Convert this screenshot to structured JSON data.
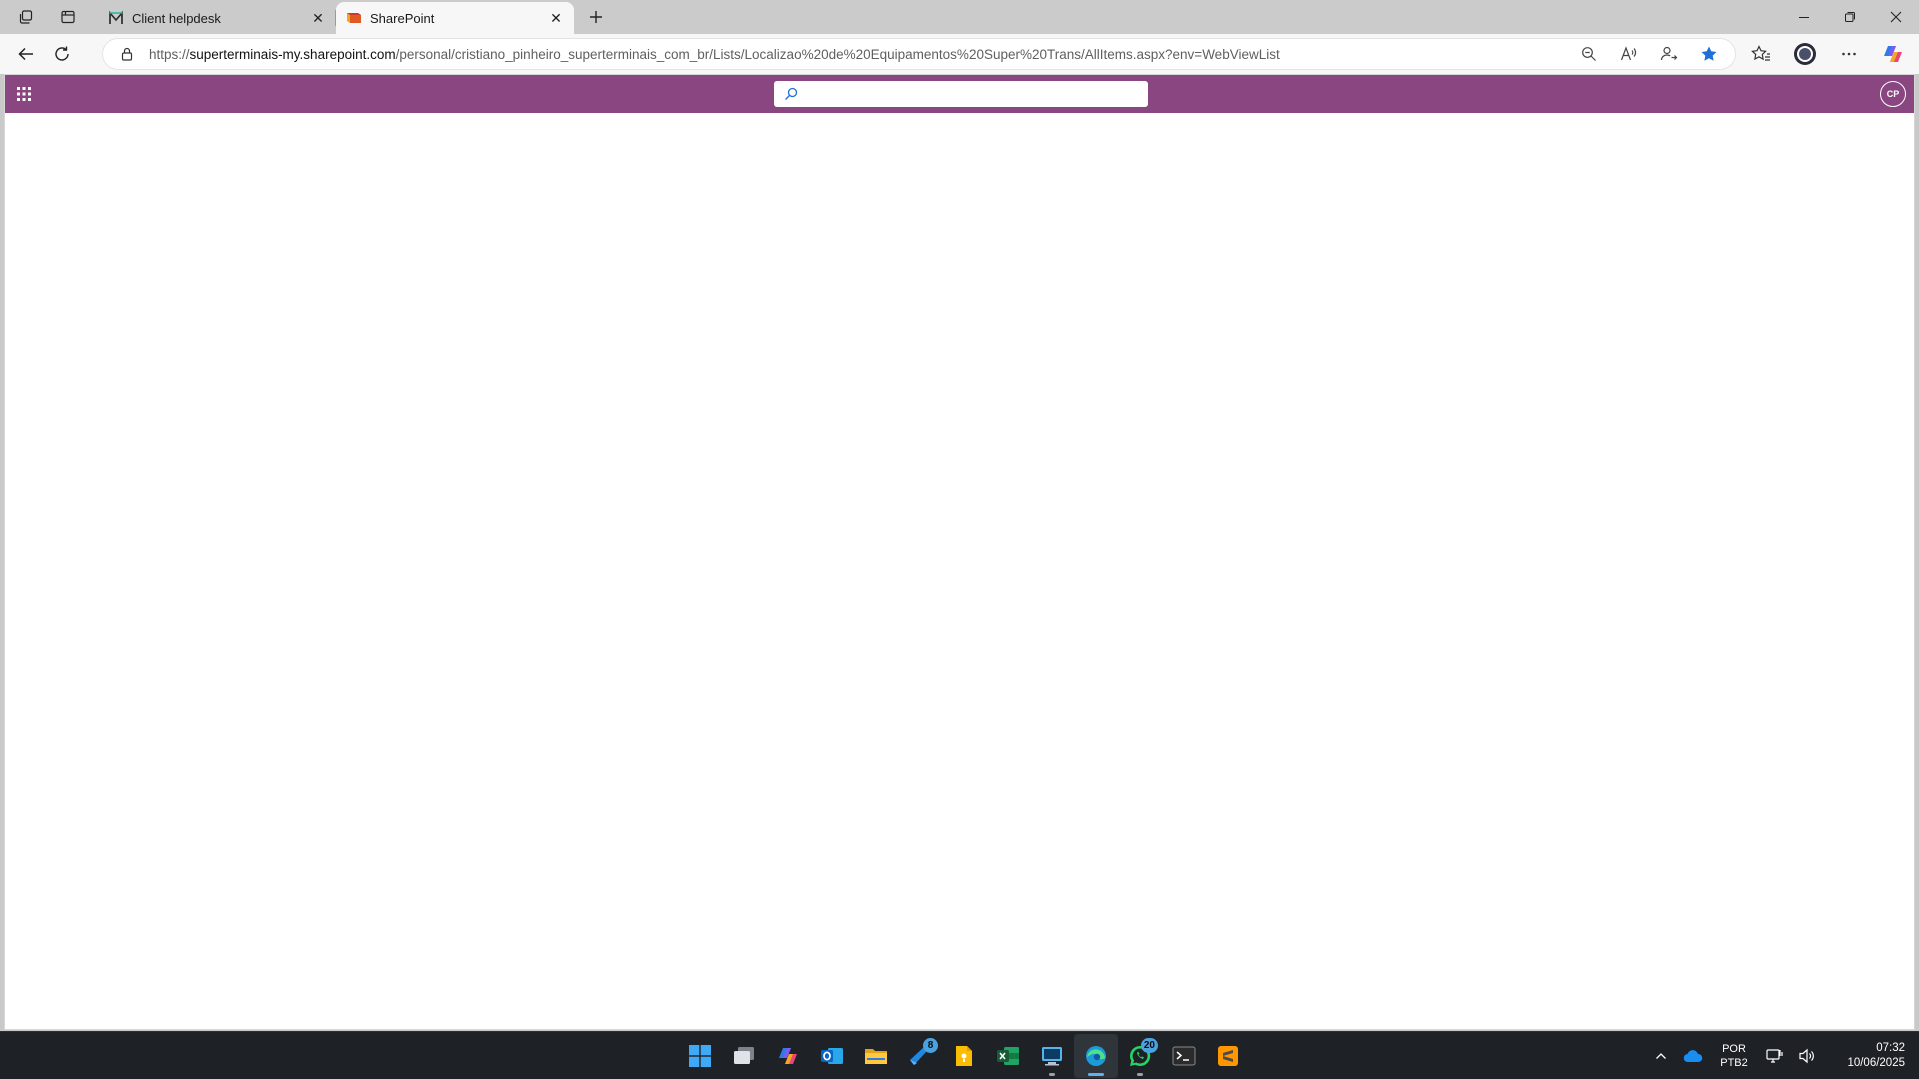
{
  "browser": {
    "tabs": [
      {
        "title": "Client helpdesk",
        "favicon": "milvus-m-icon",
        "active": false
      },
      {
        "title": "SharePoint",
        "favicon": "sharepoint-icon",
        "active": true
      }
    ],
    "address": {
      "scheme": "https://",
      "host": "superterminais-my.sharepoint.com",
      "path": "/personal/cristiano_pinheiro_superterminais_com_br/Lists/Localizao%20de%20Equipamentos%20Super%20Trans/AllItems.aspx?env=WebViewList"
    },
    "colors": {
      "tabstrip": "#cbcbcb",
      "toolbar": "#f7f7f7",
      "favorite_star": "#1f6fd6"
    }
  },
  "sharepoint": {
    "suite_bar_color": "#8a4680",
    "search": {
      "value": "",
      "placeholder": ""
    },
    "avatar_initials": "CP"
  },
  "taskbar": {
    "apps": [
      {
        "name": "start",
        "badge": null,
        "active": false,
        "running": false
      },
      {
        "name": "task-view",
        "badge": null,
        "active": false,
        "running": false
      },
      {
        "name": "copilot",
        "badge": null,
        "active": false,
        "running": false
      },
      {
        "name": "outlook",
        "badge": null,
        "active": false,
        "running": false
      },
      {
        "name": "file-explorer",
        "badge": null,
        "active": false,
        "running": false
      },
      {
        "name": "azure-devops",
        "badge": "8",
        "active": false,
        "running": false
      },
      {
        "name": "keep-notes",
        "badge": null,
        "active": false,
        "running": false
      },
      {
        "name": "excel",
        "badge": null,
        "active": false,
        "running": false
      },
      {
        "name": "remote-desktop",
        "badge": null,
        "active": false,
        "running": true
      },
      {
        "name": "edge",
        "badge": null,
        "active": true,
        "running": true
      },
      {
        "name": "whatsapp",
        "badge": "20",
        "active": false,
        "running": true
      },
      {
        "name": "terminal",
        "badge": null,
        "active": false,
        "running": false
      },
      {
        "name": "sublime-text",
        "badge": null,
        "active": false,
        "running": false
      }
    ],
    "language": {
      "line1": "POR",
      "line2": "PTB2"
    },
    "clock": {
      "time": "07:32",
      "date": "10/06/2025"
    }
  }
}
